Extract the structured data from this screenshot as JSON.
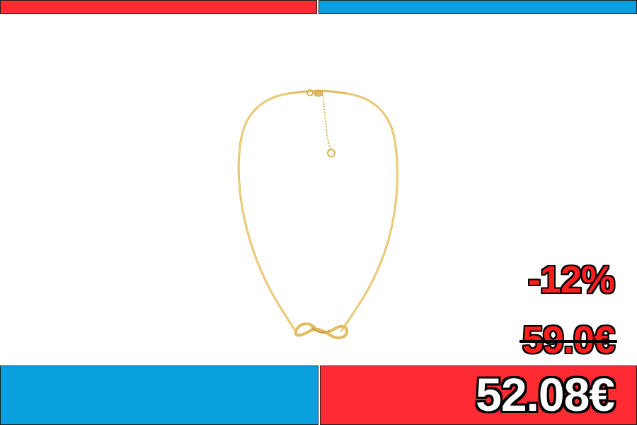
{
  "banner": {
    "top_left_color": "#ff2a32",
    "top_right_color": "#0aa0dd",
    "bottom_left_color": "#0aa0dd",
    "bottom_right_color": "#ff2a32"
  },
  "product": {
    "image_icon": "gold-necklace-icon",
    "metal_color": "#e6c062"
  },
  "pricing": {
    "discount": "-12%",
    "old_price": "59.0€",
    "new_price": "52.08€"
  }
}
